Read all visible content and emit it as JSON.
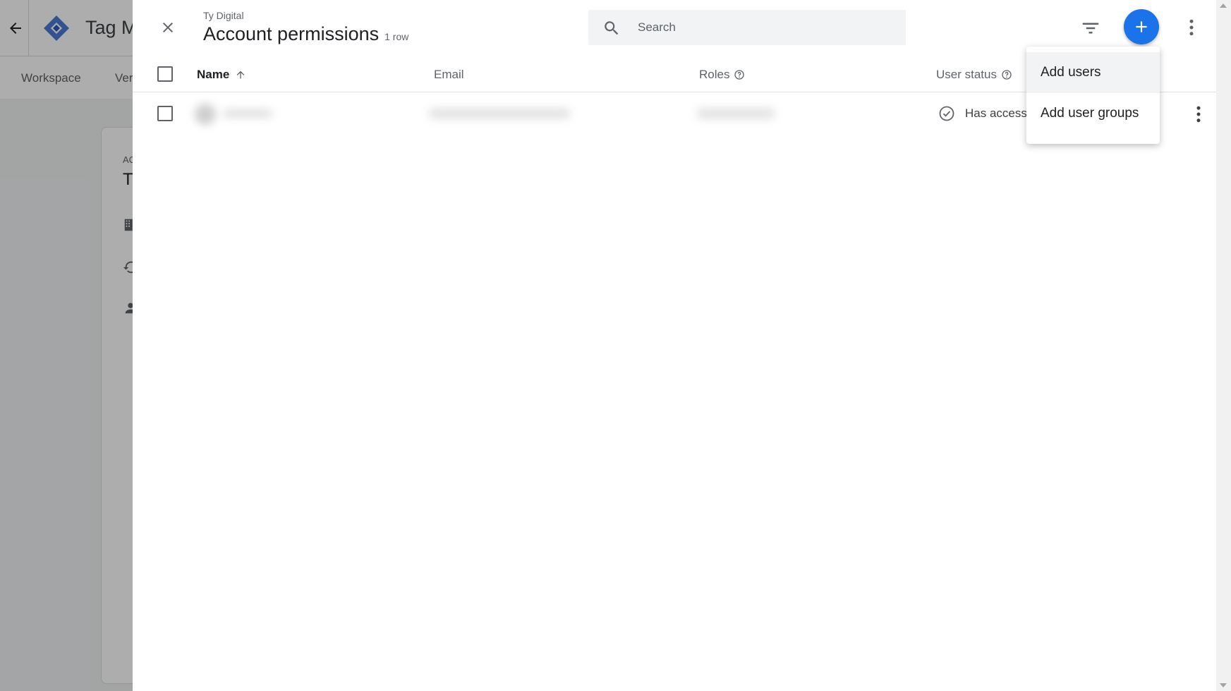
{
  "background": {
    "app_title": "Tag M",
    "tabs": [
      "Workspace",
      "Ver"
    ],
    "card": {
      "label": "AC",
      "name": "T"
    }
  },
  "panel": {
    "subtitle": "Ty Digital",
    "title": "Account permissions",
    "row_count": "1 row",
    "search": {
      "placeholder": "Search",
      "value": ""
    }
  },
  "table": {
    "columns": {
      "name": "Name",
      "email": "Email",
      "roles": "Roles",
      "user_status": "User status"
    },
    "sort": {
      "column": "name",
      "direction": "ascending"
    },
    "rows": [
      {
        "status": "Has access"
      }
    ]
  },
  "add_menu": {
    "items": [
      "Add users",
      "Add user groups"
    ]
  },
  "icons": {
    "close": "close-icon",
    "search": "search-icon",
    "filter": "filter-icon",
    "add": "plus-icon",
    "more": "more-vert-icon",
    "help": "help-circle-icon",
    "status": "check-circle-icon"
  },
  "colors": {
    "accent": "#1a73e8",
    "tag_manager_logo": "#4a7bd4",
    "scrim": "rgba(0,0,0,0.32)"
  }
}
